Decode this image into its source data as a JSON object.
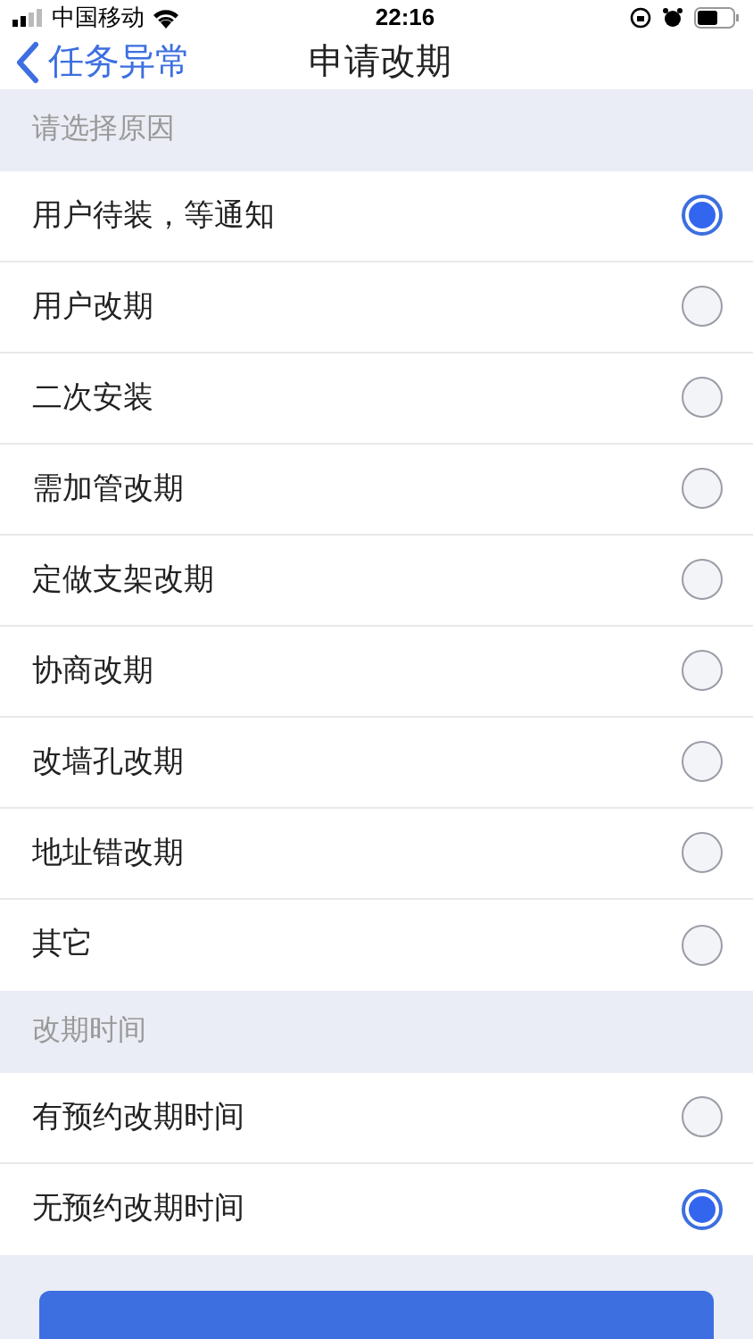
{
  "status_bar": {
    "carrier": "中国移动",
    "time": "22:16"
  },
  "nav": {
    "back_label": "任务异常",
    "title": "申请改期"
  },
  "sections": [
    {
      "header": "请选择原因",
      "options": [
        {
          "label": "用户待装，等通知",
          "selected": true
        },
        {
          "label": "用户改期",
          "selected": false
        },
        {
          "label": "二次安装",
          "selected": false
        },
        {
          "label": "需加管改期",
          "selected": false
        },
        {
          "label": "定做支架改期",
          "selected": false
        },
        {
          "label": "协商改期",
          "selected": false
        },
        {
          "label": "改墙孔改期",
          "selected": false
        },
        {
          "label": "地址错改期",
          "selected": false
        },
        {
          "label": "其它",
          "selected": false
        }
      ]
    },
    {
      "header": "改期时间",
      "options": [
        {
          "label": "有预约改期时间",
          "selected": false
        },
        {
          "label": "无预约改期时间",
          "selected": true
        }
      ]
    }
  ]
}
